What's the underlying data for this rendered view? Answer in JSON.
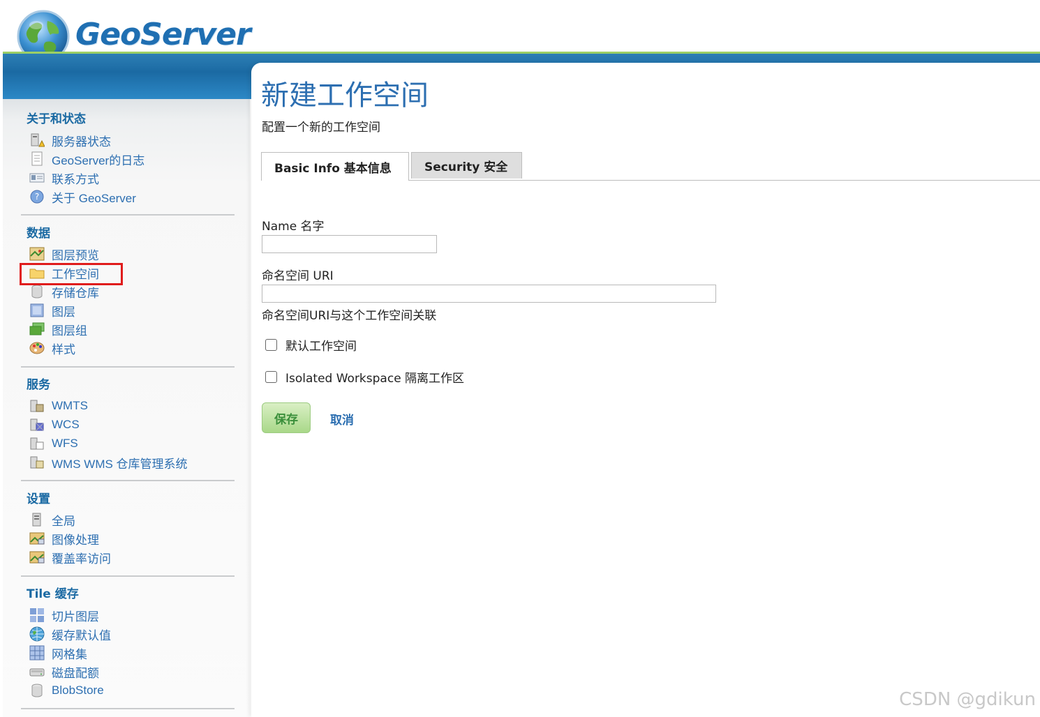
{
  "header": {
    "logo_text": "GeoServer",
    "brand_color": "#1f6fb2",
    "band_color": "#1b6aa3",
    "accent_line_color": "#9ccf66"
  },
  "sidebar": {
    "sections": [
      {
        "title": "关于和状态",
        "items": [
          {
            "label": "服务器状态",
            "icon": "server-status-icon"
          },
          {
            "label": "GeoServer的日志",
            "icon": "log-document-icon"
          },
          {
            "label": "联系方式",
            "icon": "contact-card-icon"
          },
          {
            "label": "关于 GeoServer",
            "icon": "about-info-icon"
          }
        ]
      },
      {
        "title": "数据",
        "items": [
          {
            "label": "图层预览",
            "icon": "layer-preview-icon"
          },
          {
            "label": "工作空间",
            "icon": "folder-icon",
            "highlighted": true
          },
          {
            "label": "存储仓库",
            "icon": "store-cylinder-icon"
          },
          {
            "label": "图层",
            "icon": "layer-icon"
          },
          {
            "label": "图层组",
            "icon": "layer-group-icon"
          },
          {
            "label": "样式",
            "icon": "palette-icon"
          }
        ]
      },
      {
        "title": "服务",
        "items": [
          {
            "label": "WMTS",
            "icon": "wmts-service-icon"
          },
          {
            "label": "WCS",
            "icon": "wcs-service-icon"
          },
          {
            "label": "WFS",
            "icon": "wfs-service-icon"
          },
          {
            "label": "WMS  WMS 仓库管理系统",
            "icon": "wms-service-icon"
          }
        ]
      },
      {
        "title": "设置",
        "items": [
          {
            "label": "全局",
            "icon": "global-settings-icon"
          },
          {
            "label": "图像处理",
            "icon": "image-processing-icon"
          },
          {
            "label": "覆盖率访问",
            "icon": "coverage-access-icon"
          }
        ]
      },
      {
        "title": "Tile 缓存",
        "items": [
          {
            "label": "切片图层",
            "icon": "tile-layers-icon"
          },
          {
            "label": "缓存默认值",
            "icon": "cache-defaults-globe-icon"
          },
          {
            "label": "网格集",
            "icon": "gridset-icon"
          },
          {
            "label": "磁盘配额",
            "icon": "disk-quota-icon"
          },
          {
            "label": "BlobStore",
            "icon": "blobstore-icon"
          }
        ]
      }
    ]
  },
  "main": {
    "title": "新建工作空间",
    "description": "配置一个新的工作空间",
    "tabs": [
      {
        "label": "Basic Info  基本信息",
        "active": true
      },
      {
        "label": "Security  安全",
        "active": false
      }
    ],
    "form": {
      "name_label": "Name  名字",
      "name_value": "",
      "uri_label": "命名空间 URI",
      "uri_value": "",
      "uri_help": "命名空间URI与这个工作空间关联",
      "default_label": "默认工作空间",
      "default_checked": false,
      "isolated_label": "Isolated Workspace  隔离工作区",
      "isolated_checked": false,
      "save_label": "保存",
      "cancel_label": "取消"
    }
  },
  "watermark": "CSDN @gdikun"
}
